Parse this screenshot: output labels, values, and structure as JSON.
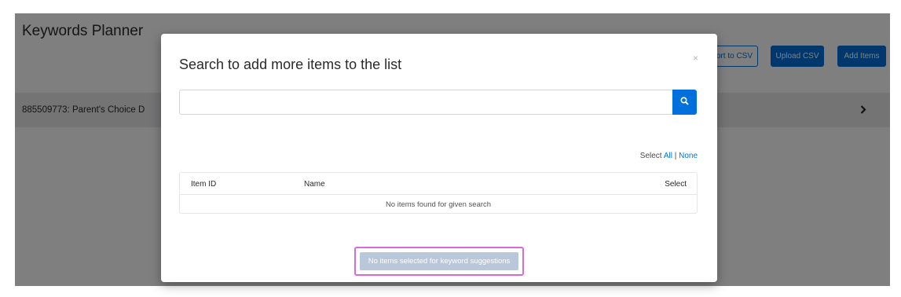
{
  "page": {
    "title": "Keywords Planner"
  },
  "toolbar": {
    "export_label": "Export to CSV",
    "upload_label": "Upload CSV",
    "add_items_label": "Add Items"
  },
  "product_row": {
    "label": "885509773: Parent's Choice D"
  },
  "modal": {
    "title": "Search to add more items to the list",
    "close_glyph": "×",
    "search_value": "",
    "search_placeholder": "",
    "select_prefix": "Select ",
    "select_all": "All",
    "select_separator": " | ",
    "select_none": "None",
    "table": {
      "columns": [
        "Item ID",
        "Name",
        "Select"
      ],
      "empty_message": "No items found for given search"
    },
    "suggest_button_label": "No items selected for keyword suggestions"
  },
  "icons": {
    "search": "search-icon",
    "chevron": "chevron-right-icon"
  },
  "colors": {
    "accent": "#0071dc",
    "disabled_button": "#b9c7da",
    "highlight": "#d86ad8"
  }
}
